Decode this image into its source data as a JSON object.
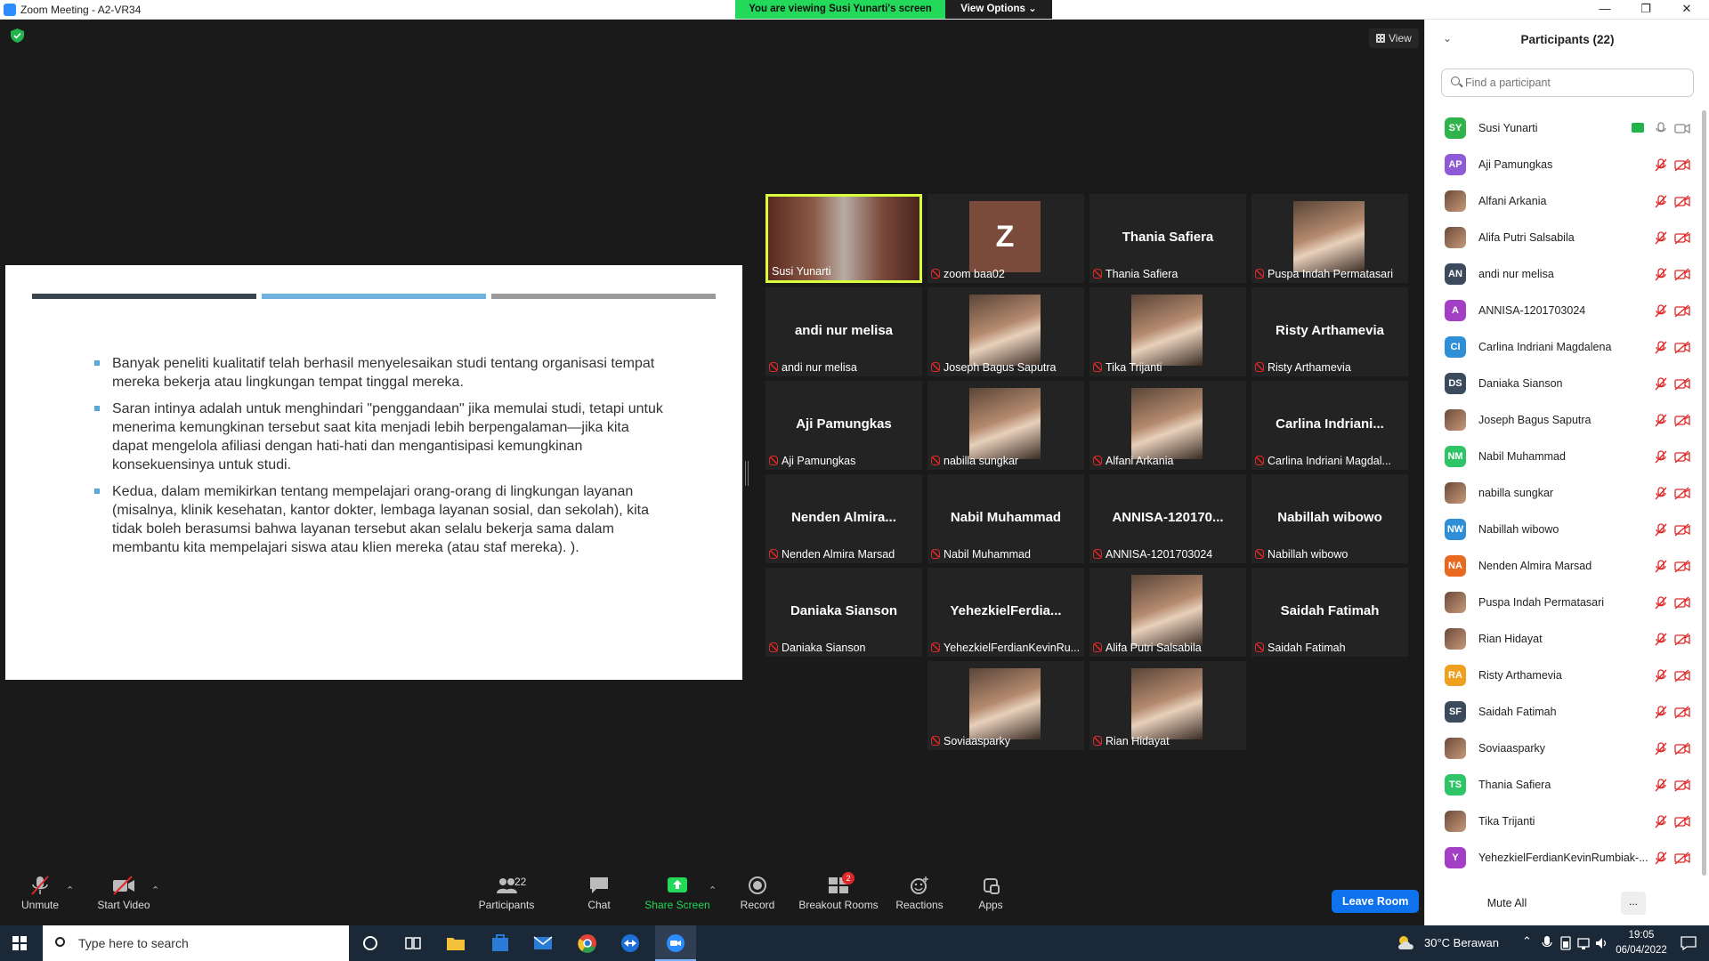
{
  "window": {
    "title": "Zoom Meeting - A2-VR34",
    "banner": "You are viewing Susi Yunarti's screen",
    "view_options": "View Options ⌄",
    "minimize": "—",
    "maximize": "❐",
    "close": "✕"
  },
  "meeting": {
    "view_label": "View"
  },
  "slide": {
    "bar_colors": [
      "#3a4550",
      "#6eb3dd",
      "#9a9a9a"
    ],
    "bullets": [
      "Banyak peneliti kualitatif telah berhasil menyelesaikan studi tentang organisasi tempat mereka bekerja atau lingkungan tempat tinggal mereka.",
      "Saran intinya adalah untuk menghindari \"penggandaan\" jika memulai studi, tetapi untuk menerima kemungkinan tersebut saat kita menjadi lebih berpengalaman—jika kita dapat mengelola afiliasi dengan hati-hati dan mengantisipasi kemungkinan konsekuensinya untuk studi.",
      "Kedua, dalam memikirkan tentang mempelajari orang-orang di lingkungan layanan (misalnya, klinik kesehatan, kantor dokter, lembaga layanan sosial, dan sekolah), kita tidak boleh berasumsi bahwa layanan tersebut akan selalu bekerja sama dalam membantu kita mempelajari siswa atau klien mereka (atau staf mereka). )."
    ]
  },
  "gallery": [
    {
      "big": "",
      "caption": "Susi Yunarti",
      "kind": "video",
      "active": true
    },
    {
      "big": "Z",
      "caption": "zoom baa02",
      "kind": "zavatar"
    },
    {
      "big": "Thania Safiera",
      "caption": "Thania Safiera",
      "kind": "name"
    },
    {
      "big": "",
      "caption": "Puspa Indah Permatasari",
      "kind": "photo"
    },
    {
      "big": "andi nur melisa",
      "caption": "andi nur melisa",
      "kind": "name"
    },
    {
      "big": "",
      "caption": "Joseph Bagus Saputra",
      "kind": "photo"
    },
    {
      "big": "",
      "caption": "Tika Trijanti",
      "kind": "photo"
    },
    {
      "big": "Risty Arthamevia",
      "caption": "Risty Arthamevia",
      "kind": "name"
    },
    {
      "big": "Aji Pamungkas",
      "caption": "Aji Pamungkas",
      "kind": "name"
    },
    {
      "big": "",
      "caption": "nabilla sungkar",
      "kind": "photo"
    },
    {
      "big": "",
      "caption": "Alfani Arkania",
      "kind": "photo"
    },
    {
      "big": "Carlina  Indriani...",
      "caption": "Carlina Indriani Magdal...",
      "kind": "name"
    },
    {
      "big": "Nenden  Almira...",
      "caption": "Nenden Almira Marsad",
      "kind": "name"
    },
    {
      "big": "Nabil Muhammad",
      "caption": "Nabil Muhammad",
      "kind": "name"
    },
    {
      "big": "ANNISA-120170...",
      "caption": "ANNISA-1201703024",
      "kind": "name"
    },
    {
      "big": "Nabillah wibowo",
      "caption": "Nabillah wibowo",
      "kind": "name"
    },
    {
      "big": "Daniaka Sianson",
      "caption": "Daniaka Sianson",
      "kind": "name"
    },
    {
      "big": "YehezkielFerdia...",
      "caption": "YehezkielFerdianKevinRu...",
      "kind": "name"
    },
    {
      "big": "",
      "caption": "Alifa Putri Salsabila",
      "kind": "photo"
    },
    {
      "big": "Saidah Fatimah",
      "caption": "Saidah Fatimah",
      "kind": "name"
    },
    {
      "big": "",
      "caption": "Soviaasparky",
      "kind": "photo"
    },
    {
      "big": "",
      "caption": "Rian Hidayat",
      "kind": "photo"
    }
  ],
  "toolbar": {
    "unmute": "Unmute",
    "start_video": "Start Video",
    "participants": "Participants",
    "participants_count": "22",
    "chat": "Chat",
    "share_screen": "Share Screen",
    "record": "Record",
    "breakout_rooms": "Breakout Rooms",
    "breakout_badge": "2",
    "reactions": "Reactions",
    "apps": "Apps",
    "leave": "Leave Room"
  },
  "panel": {
    "title": "Participants (22)",
    "search_placeholder": "Find a participant",
    "participants": [
      {
        "initials": "SY",
        "name": "Susi Yunarti",
        "color": "#2fb34a",
        "sharing": true
      },
      {
        "initials": "AP",
        "name": "Aji Pamungkas",
        "color": "#8e5ad6"
      },
      {
        "initials": "",
        "name": "Alfani Arkania",
        "color": "photo"
      },
      {
        "initials": "",
        "name": "Alifa Putri Salsabila",
        "color": "photo"
      },
      {
        "initials": "AN",
        "name": "andi nur melisa",
        "color": "#3b4a5c"
      },
      {
        "initials": "A",
        "name": "ANNISA-1201703024",
        "color": "#a33fc4"
      },
      {
        "initials": "CI",
        "name": "Carlina Indriani Magdalena",
        "color": "#2e8fd6"
      },
      {
        "initials": "DS",
        "name": "Daniaka Sianson",
        "color": "#3b4a5c"
      },
      {
        "initials": "",
        "name": "Joseph Bagus Saputra",
        "color": "photo"
      },
      {
        "initials": "NM",
        "name": "Nabil Muhammad",
        "color": "#2fc468"
      },
      {
        "initials": "",
        "name": "nabilla sungkar",
        "color": "photo"
      },
      {
        "initials": "NW",
        "name": "Nabillah wibowo",
        "color": "#2e8fd6"
      },
      {
        "initials": "NA",
        "name": "Nenden Almira Marsad",
        "color": "#e86a20"
      },
      {
        "initials": "",
        "name": "Puspa Indah Permatasari",
        "color": "photo"
      },
      {
        "initials": "",
        "name": "Rian Hidayat",
        "color": "photo"
      },
      {
        "initials": "RA",
        "name": "Risty Arthamevia",
        "color": "#f0a020"
      },
      {
        "initials": "SF",
        "name": "Saidah Fatimah",
        "color": "#3b4a5c"
      },
      {
        "initials": "",
        "name": "Soviaasparky",
        "color": "photo"
      },
      {
        "initials": "TS",
        "name": "Thania Safiera",
        "color": "#2fc468"
      },
      {
        "initials": "",
        "name": "Tika Trijanti",
        "color": "photo"
      },
      {
        "initials": "Y",
        "name": "YehezkielFerdianKevinRumbiak-...",
        "color": "#a33fc4"
      }
    ],
    "mute_all": "Mute All",
    "more": "..."
  },
  "taskbar": {
    "search_placeholder": "Type here to search",
    "weather": "30°C  Berawan",
    "time": "19:05",
    "date": "06/04/2022"
  }
}
